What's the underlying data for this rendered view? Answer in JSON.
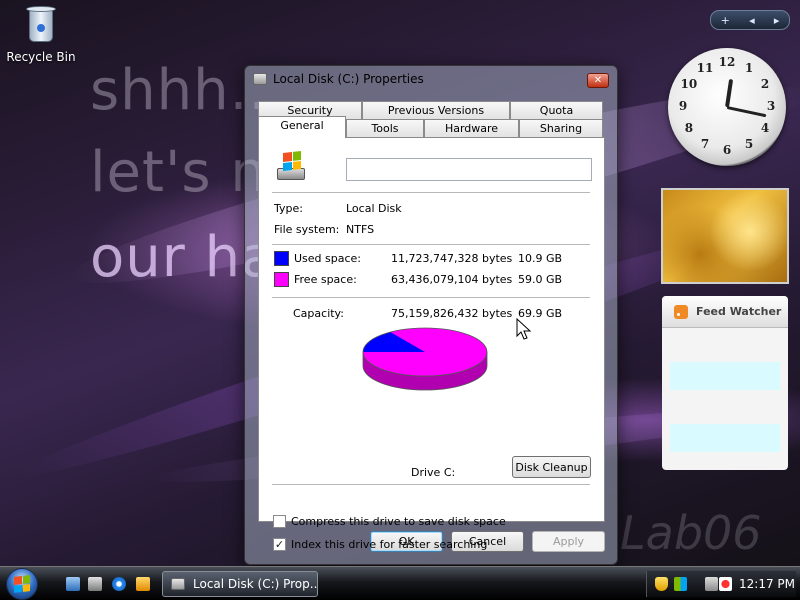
{
  "desktop": {
    "wallpaper_text": [
      "shhh..",
      "let's n",
      "our ha",
      "Lab06"
    ],
    "icons": [
      {
        "label": "Recycle Bin",
        "icon": "recycle-bin-icon"
      }
    ]
  },
  "sidebar": {
    "controls": {
      "add": "+",
      "prev": "◂",
      "next": "▸"
    },
    "clock": {
      "numbers": [
        "12",
        "1",
        "2",
        "3",
        "4",
        "5",
        "6",
        "7",
        "8",
        "9",
        "10",
        "11"
      ],
      "hour": 12,
      "minute": 17
    },
    "feed_watcher": {
      "title": "Feed Watcher",
      "icon": "rss-icon"
    }
  },
  "dialog": {
    "title": "Local Disk (C:) Properties",
    "close_label": "✕",
    "tabs_top": [
      "Security",
      "Previous Versions",
      "Quota"
    ],
    "tabs_bottom": [
      "General",
      "Tools",
      "Hardware",
      "Sharing"
    ],
    "active_tab": "General",
    "name_value": "",
    "type_label": "Type:",
    "type_value": "Local Disk",
    "fs_label": "File system:",
    "fs_value": "NTFS",
    "used": {
      "label": "Used space:",
      "bytes": "11,723,747,328 bytes",
      "size": "10.9 GB",
      "color": "#0000ff"
    },
    "free": {
      "label": "Free space:",
      "bytes": "63,436,079,104 bytes",
      "size": "59.0 GB",
      "color": "#ff00ff"
    },
    "capacity": {
      "label": "Capacity:",
      "bytes": "75,159,826,432 bytes",
      "size": "69.9 GB"
    },
    "drive_label": "Drive C:",
    "used_fraction": 0.156,
    "cleanup_label": "Disk Cleanup",
    "compress_label": "Compress this drive to save disk space",
    "compress_checked": false,
    "index_label": "Index this drive for faster searching",
    "index_checked": true,
    "ok_label": "OK",
    "cancel_label": "Cancel",
    "apply_label": "Apply"
  },
  "taskbar": {
    "start_icon": "windows-start-icon",
    "quick_launch": [
      "show-desktop-icon",
      "switch-windows-icon",
      "internet-explorer-icon",
      "media-player-icon"
    ],
    "task": "Local Disk (C:) Prop...",
    "tray_icons": [
      "security-shield-icon",
      "network-icon",
      "volume-muted-icon"
    ],
    "time": "12:17 PM"
  }
}
